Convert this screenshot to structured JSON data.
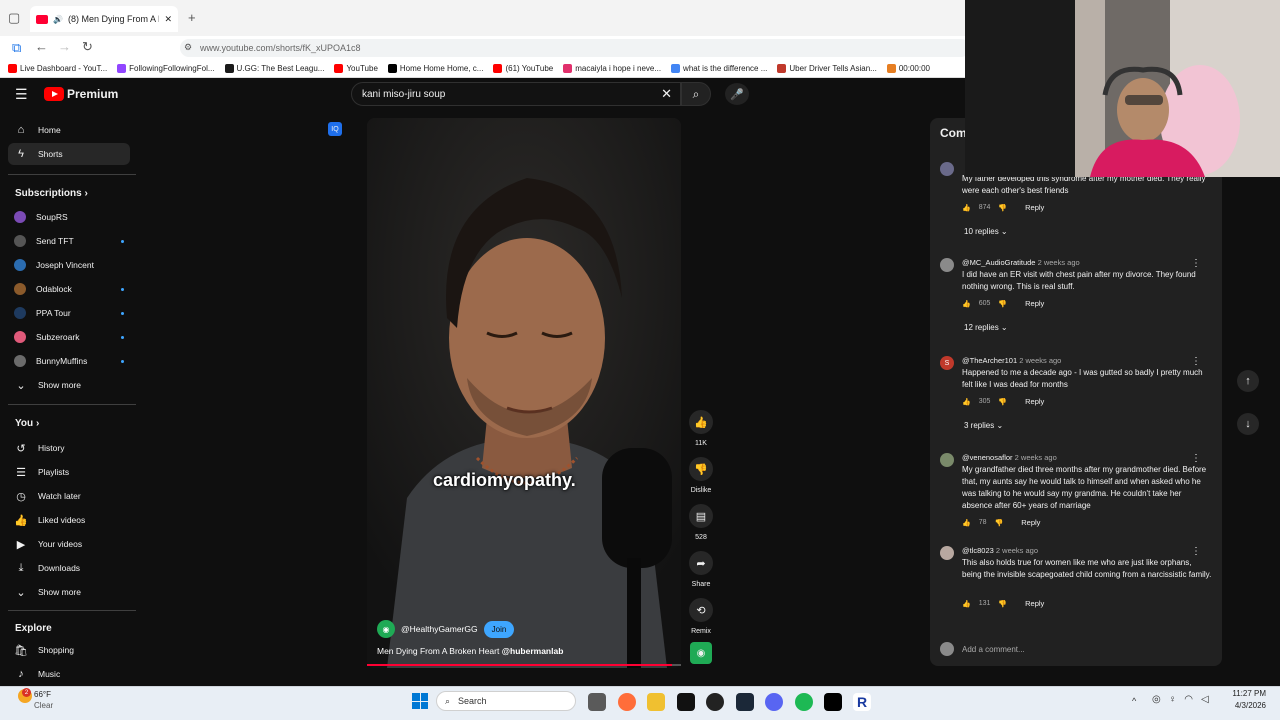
{
  "browser": {
    "tab_title": "(8) Men Dying From A Broke",
    "url": "www.youtube.com/shorts/fK_xUPOA1c8",
    "bookmarks": [
      {
        "label": "Live Dashboard - YouT...",
        "color": "#ff0000"
      },
      {
        "label": "FollowingFollowingFol...",
        "color": "#9146ff"
      },
      {
        "label": "U.GG: The Best Leagu...",
        "color": "#1a1a1a"
      },
      {
        "label": "YouTube",
        "color": "#ff0000"
      },
      {
        "label": "Home Home Home, c...",
        "color": "#000000"
      },
      {
        "label": "(61) YouTube",
        "color": "#ff0000"
      },
      {
        "label": "macaiyla i hope i neve...",
        "color": "#e1306c"
      },
      {
        "label": "what is the difference ...",
        "color": "#4285f4"
      },
      {
        "label": "Uber Driver Tells Asian...",
        "color": "#c0392b"
      },
      {
        "label": "00:00:00",
        "color": "#e67e22"
      }
    ]
  },
  "youtube": {
    "logo_text": "Premium",
    "search_query": "kani miso-jiru soup"
  },
  "sidebar": {
    "main": [
      {
        "label": "Home",
        "icon": "home-icon",
        "glyph": "⌂"
      },
      {
        "label": "Shorts",
        "icon": "shorts-icon",
        "glyph": "ϟ"
      }
    ],
    "subscriptions_title": "Subscriptions",
    "subscriptions": [
      {
        "label": "SoupRS",
        "color": "#7b4bb5",
        "live": false
      },
      {
        "label": "Send TFT",
        "color": "#555555",
        "live": true
      },
      {
        "label": "Joseph Vincent",
        "color": "#2b6cb0",
        "live": false
      },
      {
        "label": "Odablock",
        "color": "#8b5a2b",
        "live": true
      },
      {
        "label": "PPA Tour",
        "color": "#1e3a5f",
        "live": true
      },
      {
        "label": "Subzeroark",
        "color": "#e05a7a",
        "live": true
      },
      {
        "label": "BunnyMuffins",
        "color": "#6b6b6b",
        "live": true
      }
    ],
    "show_more": "Show more",
    "you_title": "You",
    "you_items": [
      {
        "label": "History",
        "icon": "history-icon",
        "glyph": "↺"
      },
      {
        "label": "Playlists",
        "icon": "playlists-icon",
        "glyph": "☰"
      },
      {
        "label": "Watch later",
        "icon": "watch-later-icon",
        "glyph": "◷"
      },
      {
        "label": "Liked videos",
        "icon": "like-icon",
        "glyph": "👍"
      },
      {
        "label": "Your videos",
        "icon": "your-videos-icon",
        "glyph": "▶"
      },
      {
        "label": "Downloads",
        "icon": "download-icon",
        "glyph": "⤓"
      }
    ],
    "explore_title": "Explore",
    "explore_items": [
      {
        "label": "Shopping",
        "icon": "shopping-icon",
        "glyph": "🛍"
      },
      {
        "label": "Music",
        "icon": "music-icon",
        "glyph": "♪"
      }
    ]
  },
  "video": {
    "caption": "cardiomyopathy.",
    "channel": "@HealthyGamerGG",
    "join_label": "Join",
    "title": "Men Dying From A Broken Heart",
    "title_tag": "@hubermanlab",
    "progress": 0.97,
    "actions": {
      "like_count": "11K",
      "dislike_label": "Dislike",
      "comment_count": "528",
      "share_label": "Share",
      "remix_label": "Remix"
    }
  },
  "comments": {
    "header": "Com",
    "items": [
      {
        "user": "",
        "time": "",
        "text": "My father developed this syndrome after my mother died. They really were each other's best friends",
        "likes": "874",
        "replies": "10 replies",
        "color": "#6a6a8a"
      },
      {
        "user": "@MC_AudioGratitude",
        "time": "2 weeks ago",
        "text": "I did have an ER visit with chest pain after my divorce.  They found nothing wrong.  This is real stuff.",
        "likes": "605",
        "replies": "12 replies",
        "color": "#8a8a8a"
      },
      {
        "user": "@TheArcher101",
        "time": "2 weeks ago",
        "text": "Happened to me a decade ago - I was gutted so badly I pretty much felt like I was dead for months",
        "likes": "305",
        "replies": "3 replies",
        "color": "#c0392b",
        "initial": "S"
      },
      {
        "user": "@venenosaflor",
        "time": "2 weeks ago",
        "text": "My grandfather died three months after my grandmother died. Before that, my aunts say he would talk to himself and when asked who he was talking to he would say my grandma. He couldn't take her absence after 60+ years of marriage",
        "likes": "78",
        "replies": "",
        "color": "#7a8a6a"
      },
      {
        "user": "@tlc8023",
        "time": "2 weeks ago",
        "text": "This also holds true for women like me who are just like orphans, being the invisible scapegoated child coming from a narcissistic family.",
        "likes": "131",
        "replies": "",
        "color": "#b8a8a0"
      }
    ],
    "reply_label": "Reply",
    "add_comment_placeholder": "Add a comment..."
  },
  "taskbar": {
    "weather_temp": "66°F",
    "weather_desc": "Clear",
    "weather_badge": "2",
    "search_label": "Search",
    "time": "11:27 PM",
    "date": "4/3/2026"
  }
}
